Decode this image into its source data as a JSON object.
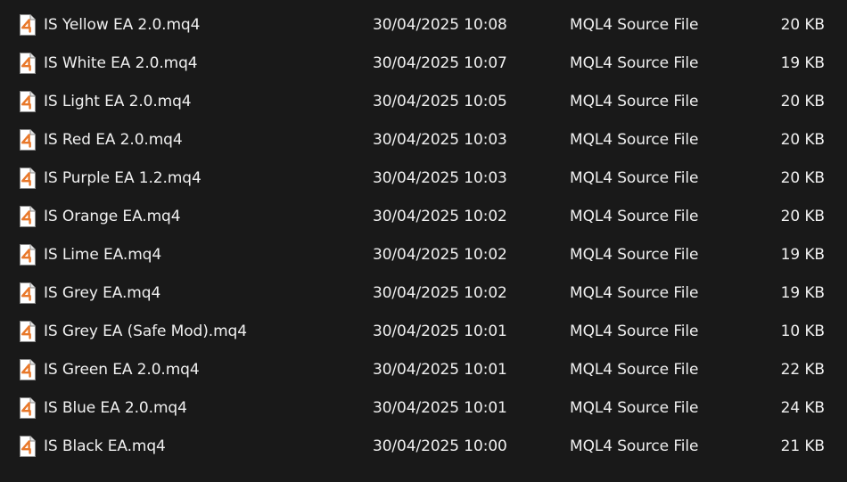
{
  "files": [
    {
      "name": "IS Yellow EA 2.0.mq4",
      "date": "30/04/2025 10:08",
      "type": "MQL4 Source File",
      "size": "20 KB",
      "icon": "mq4-file-icon"
    },
    {
      "name": "IS White EA 2.0.mq4",
      "date": "30/04/2025 10:07",
      "type": "MQL4 Source File",
      "size": "19 KB",
      "icon": "mq4-file-icon"
    },
    {
      "name": "IS Light EA 2.0.mq4",
      "date": "30/04/2025 10:05",
      "type": "MQL4 Source File",
      "size": "20 KB",
      "icon": "mq4-file-icon"
    },
    {
      "name": "IS Red EA 2.0.mq4",
      "date": "30/04/2025 10:03",
      "type": "MQL4 Source File",
      "size": "20 KB",
      "icon": "mq4-file-icon"
    },
    {
      "name": "IS Purple EA 1.2.mq4",
      "date": "30/04/2025 10:03",
      "type": "MQL4 Source File",
      "size": "20 KB",
      "icon": "mq4-file-icon"
    },
    {
      "name": "IS Orange EA.mq4",
      "date": "30/04/2025 10:02",
      "type": "MQL4 Source File",
      "size": "20 KB",
      "icon": "mq4-file-icon"
    },
    {
      "name": "IS Lime EA.mq4",
      "date": "30/04/2025 10:02",
      "type": "MQL4 Source File",
      "size": "19 KB",
      "icon": "mq4-file-icon"
    },
    {
      "name": "IS Grey EA.mq4",
      "date": "30/04/2025 10:02",
      "type": "MQL4 Source File",
      "size": "19 KB",
      "icon": "mq4-file-icon"
    },
    {
      "name": "IS Grey EA (Safe Mod).mq4",
      "date": "30/04/2025 10:01",
      "type": "MQL4 Source File",
      "size": "10 KB",
      "icon": "mq4-file-icon"
    },
    {
      "name": "IS Green EA 2.0.mq4",
      "date": "30/04/2025 10:01",
      "type": "MQL4 Source File",
      "size": "22 KB",
      "icon": "mq4-file-icon"
    },
    {
      "name": "IS Blue EA 2.0.mq4",
      "date": "30/04/2025 10:01",
      "type": "MQL4 Source File",
      "size": "24 KB",
      "icon": "mq4-file-icon"
    },
    {
      "name": "IS Black EA.mq4",
      "date": "30/04/2025 10:00",
      "type": "MQL4 Source File",
      "size": "21 KB",
      "icon": "mq4-file-icon"
    }
  ],
  "colors": {
    "background": "#191919",
    "text": "#f0f0f0",
    "icon_accent": "#e8782a"
  }
}
